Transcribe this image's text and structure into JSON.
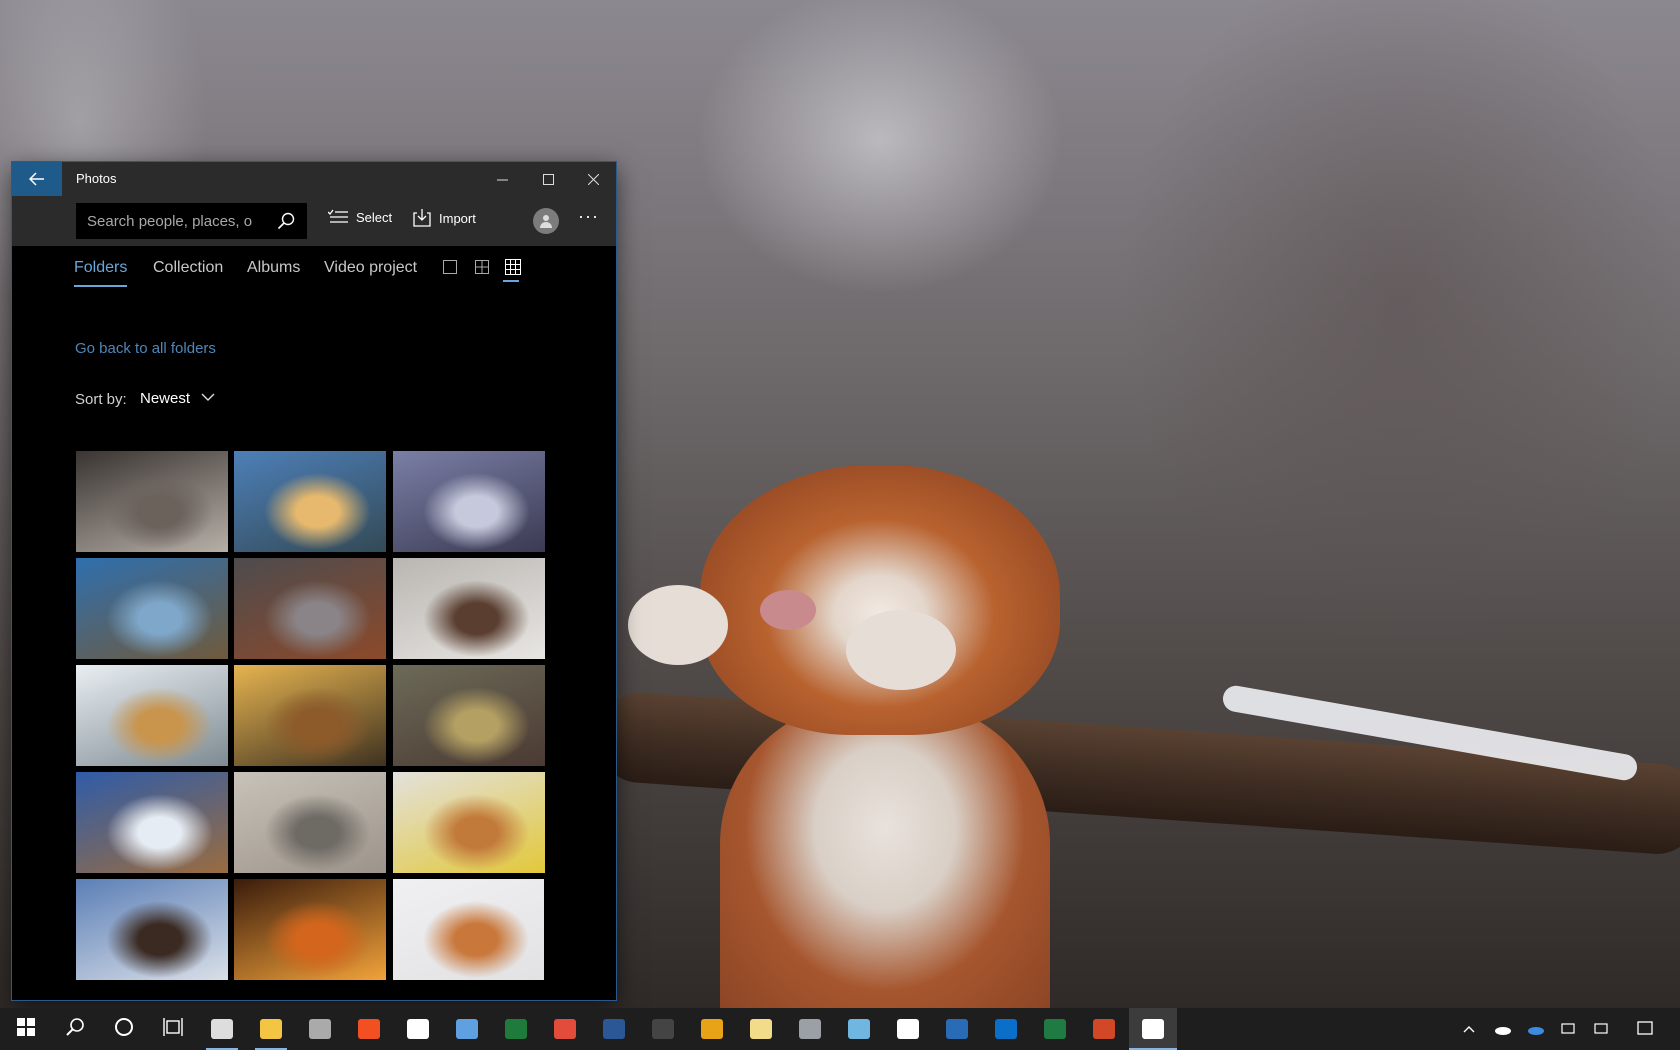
{
  "window": {
    "title": "Photos",
    "minimize_icon": "minimize-icon",
    "maximize_icon": "maximize-icon",
    "close_icon": "close-icon"
  },
  "toolbar": {
    "search_placeholder": "Search people, places, or things...",
    "search_display": "Search people, places, o",
    "select_label": "Select",
    "import_label": "Import",
    "more_label": "···"
  },
  "tabs": [
    {
      "label": "Folders",
      "active": true
    },
    {
      "label": "Collection",
      "active": false
    },
    {
      "label": "Albums",
      "active": false
    },
    {
      "label": "Video project",
      "active": false
    }
  ],
  "view_options": [
    {
      "icon": "single-view-icon",
      "active": false
    },
    {
      "icon": "medium-grid-icon",
      "active": false
    },
    {
      "icon": "small-grid-icon",
      "active": true
    }
  ],
  "folder": {
    "go_back_label": "Go back to all folders",
    "sort_label": "Sort by:",
    "sort_value": "Newest"
  },
  "thumbnails": [
    {
      "subject": "two dogs in doorway",
      "colors": [
        "#3a3432",
        "#6b625c",
        "#b7b0a8"
      ]
    },
    {
      "subject": "mountain sunrise",
      "colors": [
        "#4d7fb8",
        "#e6b96e",
        "#334a56"
      ]
    },
    {
      "subject": "two dogs in frosty grass",
      "colors": [
        "#7a7fa6",
        "#c6c8dc",
        "#3b3a52"
      ]
    },
    {
      "subject": "dog on lake rock",
      "colors": [
        "#2f6fae",
        "#7fa7c9",
        "#6f5a3c"
      ]
    },
    {
      "subject": "dog with stick",
      "colors": [
        "#4d4b4e",
        "#8a8488",
        "#8c4a2a"
      ]
    },
    {
      "subject": "spaniel in snow",
      "colors": [
        "#b9b6b2",
        "#5a3e30",
        "#e8e6e2"
      ]
    },
    {
      "subject": "golden retriever in snow",
      "colors": [
        "#e9eef2",
        "#c9944c",
        "#7e8b92"
      ]
    },
    {
      "subject": "dog in golden light",
      "colors": [
        "#e6b451",
        "#8d5a2a",
        "#3f3220"
      ]
    },
    {
      "subject": "small dog with blanket",
      "colors": [
        "#6c6a58",
        "#b4a063",
        "#4b3a32"
      ]
    },
    {
      "subject": "dog on snowy mountain",
      "colors": [
        "#2f5ca8",
        "#e6ecf3",
        "#9a6c40"
      ]
    },
    {
      "subject": "sled dogs",
      "colors": [
        "#c8c2b8",
        "#6e6a64",
        "#9c948a"
      ]
    },
    {
      "subject": "dog with frisbee",
      "colors": [
        "#e3e1dc",
        "#c27a3a",
        "#e2c83a"
      ]
    },
    {
      "subject": "chocolate labrador",
      "colors": [
        "#5b7fb6",
        "#3a2a22",
        "#d9dfe8"
      ]
    },
    {
      "subject": "dog by fireplace",
      "colors": [
        "#3a1c0c",
        "#d4651c",
        "#f2a23a"
      ]
    },
    {
      "subject": "collie in snow",
      "colors": [
        "#f0f0f2",
        "#c9773a",
        "#e2e2e4"
      ]
    }
  ],
  "taskbar": {
    "items": [
      {
        "icon": "windows-start-icon"
      },
      {
        "icon": "search-icon"
      },
      {
        "icon": "cortana-icon"
      },
      {
        "icon": "task-view-icon"
      },
      {
        "icon": "settings-icon",
        "running": true
      },
      {
        "icon": "file-explorer-icon",
        "running": true
      },
      {
        "icon": "camera-icon"
      },
      {
        "icon": "store-icon"
      },
      {
        "icon": "mail-icon"
      },
      {
        "icon": "visual-studio-icon"
      },
      {
        "icon": "edge-dev-icon"
      },
      {
        "icon": "chrome-icon"
      },
      {
        "icon": "word-icon"
      },
      {
        "icon": "terminal-icon"
      },
      {
        "icon": "edge-canary-icon"
      },
      {
        "icon": "notepad-icon"
      },
      {
        "icon": "package-icon"
      },
      {
        "icon": "remote-desktop-icon"
      },
      {
        "icon": "security-shield-icon"
      },
      {
        "icon": "powershell-icon"
      },
      {
        "icon": "edge-beta-icon"
      },
      {
        "icon": "excel-icon"
      },
      {
        "icon": "powerpoint-icon"
      },
      {
        "icon": "photos-icon",
        "running": true,
        "active": true
      }
    ],
    "tray": [
      {
        "icon": "chevron-up-icon"
      },
      {
        "icon": "onedrive-icon"
      },
      {
        "icon": "onedrive-blue-icon"
      },
      {
        "icon": "network-icon"
      },
      {
        "icon": "volume-icon"
      },
      {
        "icon": "notifications-icon"
      }
    ]
  }
}
